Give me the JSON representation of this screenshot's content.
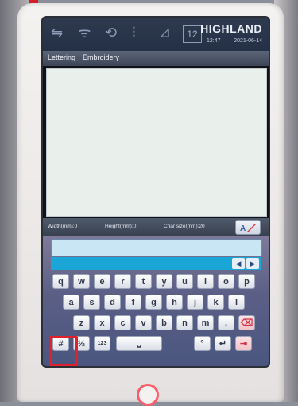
{
  "statusbar": {
    "icons": [
      "transfer-icon",
      "wifi-icon",
      "sync-icon",
      "adjust-icon",
      "network-icon"
    ],
    "needle_count": "12",
    "brand": "HIGHLAND",
    "time": "12:47",
    "date": "2021-06-14"
  },
  "tabs": [
    {
      "label": "Lettering"
    },
    {
      "label": "Embroidery"
    }
  ],
  "infobar": {
    "width": "Width(mm):0",
    "height": "Height(mm):0",
    "char_size": "Char size(mm):20"
  },
  "keyboard": {
    "row1": [
      "q",
      "w",
      "e",
      "r",
      "t",
      "y",
      "u",
      "i",
      "o",
      "p"
    ],
    "row2": [
      "a",
      "s",
      "d",
      "f",
      "g",
      "h",
      "j",
      "k",
      "l"
    ],
    "row3": [
      "z",
      "x",
      "c",
      "v",
      "b",
      "n",
      "m",
      ","
    ],
    "mode_keys": [
      "#",
      "½",
      "123"
    ],
    "period": "°",
    "enter": "↵"
  },
  "colors": {
    "accent": "#1aa7d8",
    "highlight": "#e2202c"
  }
}
